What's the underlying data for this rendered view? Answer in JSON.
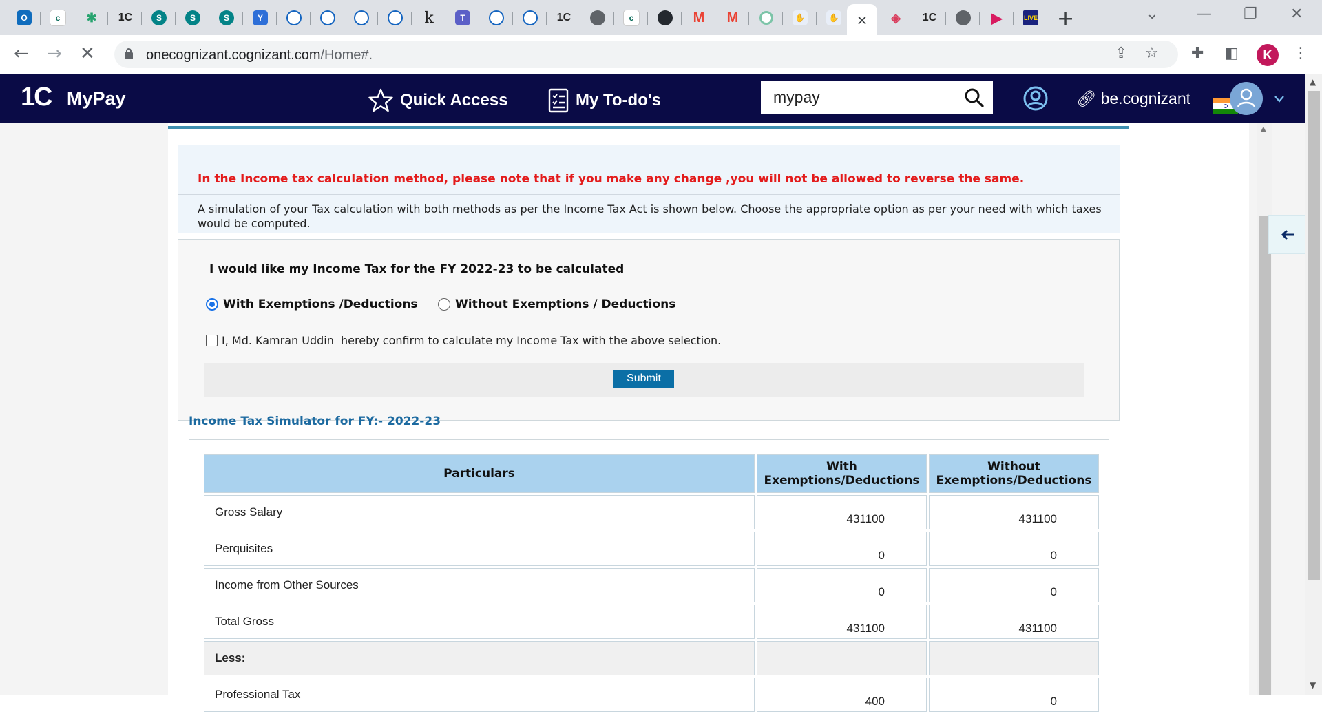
{
  "browser": {
    "tabs": [
      "outlook",
      "cognizant",
      "app",
      "1C",
      "sharepoint",
      "sharepoint",
      "sharepoint",
      "viva-engage",
      "app",
      "app",
      "app",
      "app",
      "k",
      "teams",
      "app",
      "app",
      "1C",
      "globe",
      "cognizant",
      "github",
      "gmail",
      "gmail",
      "app",
      "app",
      "app",
      "active",
      "app",
      "1C",
      "globe",
      "video",
      "app"
    ],
    "tab_labels": {
      "one_c": "1C",
      "k": "k",
      "close": "×"
    },
    "url_host": "onecognizant.cognizant.com",
    "url_path": "/Home#.",
    "profile_initial": "K"
  },
  "header": {
    "logo": "1C",
    "brand": "MyPay",
    "quick_access": "Quick Access",
    "todos": "My To-do's",
    "search_value": "mypay",
    "be_link": "be.cognizant"
  },
  "notice": {
    "warning": "In the Income tax calculation method, please note that if you make any change ,you will not be allowed to reverse the same.",
    "description": "A simulation of your Tax calculation with both methods as per the Income Tax Act is shown below. Choose the appropriate option as per your need with which taxes would be computed."
  },
  "selection": {
    "question": "I would like my Income Tax for the FY 2022-23 to be calculated",
    "option_with": "With Exemptions /Deductions",
    "option_without": "Without Exemptions / Deductions",
    "selected": "with",
    "confirm_text": "I, Md. Kamran Uddin  hereby confirm to calculate my Income Tax with the above selection.",
    "submit_label": "Submit"
  },
  "simulator": {
    "title": "Income Tax Simulator for FY:- 2022-23",
    "headers": {
      "particulars": "Particulars",
      "with_1": "With",
      "with_2": "Exemptions/Deductions",
      "without_1": "Without",
      "without_2": "Exemptions/Deductions"
    },
    "rows": [
      {
        "label": "Gross Salary",
        "with": "431100",
        "without": "431100"
      },
      {
        "label": "Perquisites",
        "with": "0",
        "without": "0"
      },
      {
        "label": "Income from Other Sources",
        "with": "0",
        "without": "0"
      },
      {
        "label": "Total Gross",
        "with": "431100",
        "without": "431100"
      },
      {
        "label": "Less:",
        "with": "",
        "without": ""
      },
      {
        "label": "Professional Tax",
        "with": "400",
        "without": "0"
      }
    ]
  },
  "colors": {
    "header_bg": "#0a0b46",
    "warning_text": "#e31b1b",
    "table_header_bg": "#aad2ee",
    "simulator_title": "#1c6aa0",
    "submit_bg": "#0b6fa6"
  }
}
